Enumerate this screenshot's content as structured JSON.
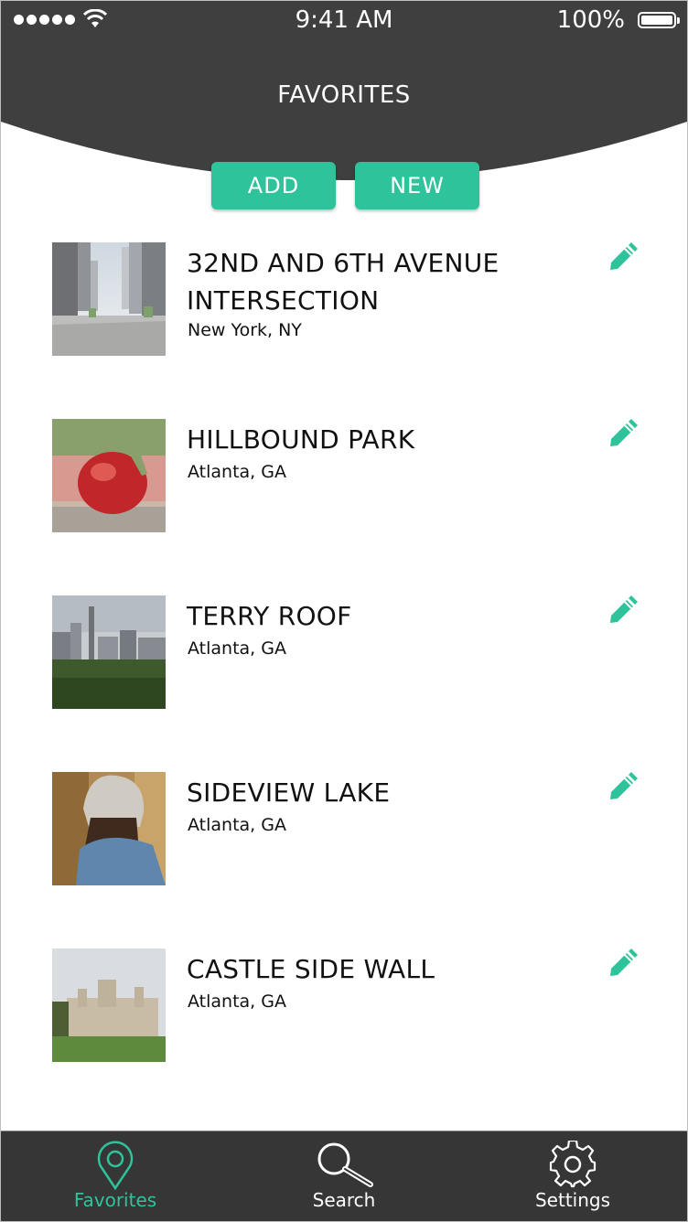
{
  "status_bar": {
    "time": "9:41 AM",
    "battery": "100%"
  },
  "header": {
    "title": "FAVORITES"
  },
  "actions": {
    "add_label": "ADD",
    "new_label": "NEW"
  },
  "favorites": [
    {
      "title": "32ND AND 6TH AVENUE INTERSECTION",
      "location": "New York, NY"
    },
    {
      "title": "HILLBOUND PARK",
      "location": "Atlanta, GA"
    },
    {
      "title": "TERRY ROOF",
      "location": "Atlanta, GA"
    },
    {
      "title": "SIDEVIEW LAKE",
      "location": "Atlanta, GA"
    },
    {
      "title": "CASTLE SIDE WALL",
      "location": "Atlanta, GA"
    }
  ],
  "tabs": [
    {
      "label": "Favorites",
      "icon": "map-pin-icon",
      "active": true
    },
    {
      "label": "Search",
      "icon": "search-icon",
      "active": false
    },
    {
      "label": "Settings",
      "icon": "gear-icon",
      "active": false
    }
  ],
  "colors": {
    "header": "#3f3f3f",
    "accent": "#2ec39a",
    "tabbar": "#363636"
  }
}
